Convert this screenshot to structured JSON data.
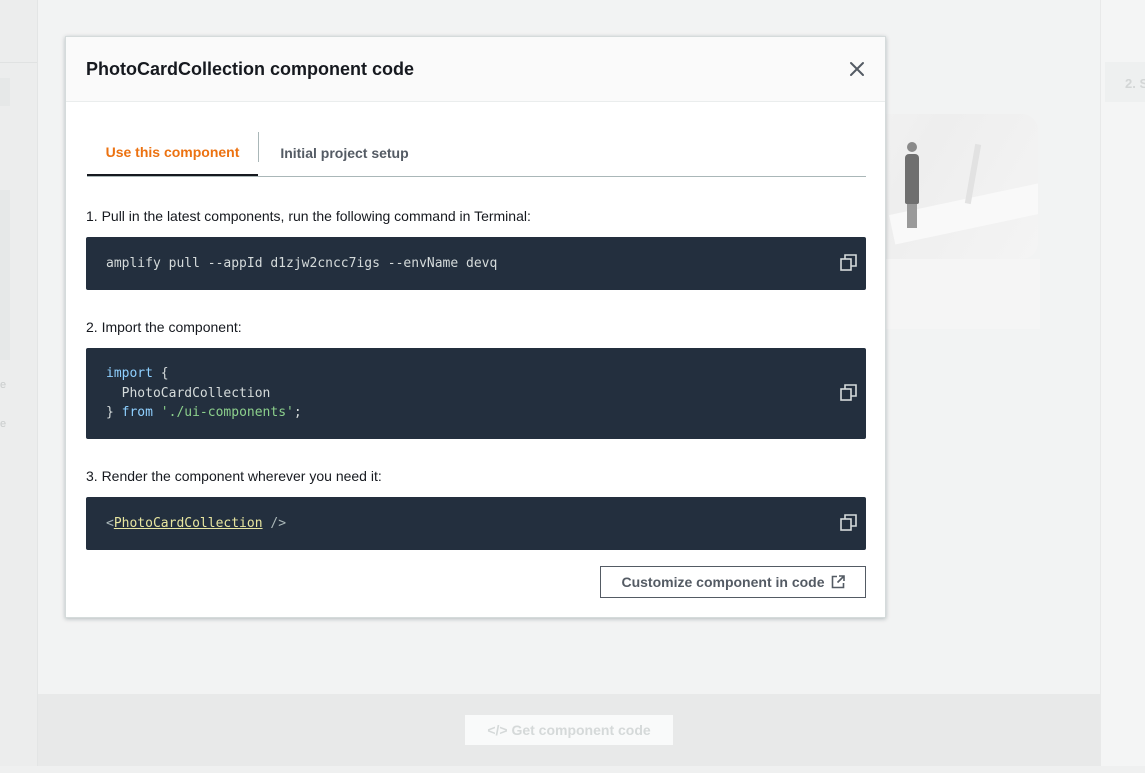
{
  "background": {
    "step_label": "2. S",
    "left_ghost_1": "e",
    "left_ghost_2": "e",
    "footer_button_label": "</> Get component code"
  },
  "modal": {
    "title": "PhotoCardCollection component code",
    "close_icon": "close-icon",
    "tabs": [
      {
        "label": "Use this component",
        "active": true
      },
      {
        "label": "Initial project setup",
        "active": false
      }
    ],
    "steps": [
      {
        "label": "1. Pull in the latest components, run the following command in Terminal:",
        "code": "amplify pull --appId d1zjw2cncc7igs --envName devq"
      },
      {
        "label": "2. Import the component:",
        "code_lines": {
          "l1_kw": "import",
          "l1_rest": " {",
          "l2": "  PhotoCardCollection",
          "l3_brace": "} ",
          "l3_kw": "from",
          "l3_space": " ",
          "l3_str": "'./ui-components'",
          "l3_end": ";"
        }
      },
      {
        "label": "3. Render the component wherever you need it:",
        "code_parts": {
          "open": "<",
          "component": "PhotoCardCollection",
          "close": " />"
        }
      }
    ],
    "copy_icon": "copy-icon",
    "customize_button_label": "Customize component in code",
    "external_link_icon": "external-link-icon"
  },
  "colors": {
    "active_tab": "#ec7211",
    "code_background": "#232f3e",
    "keyword": "#8fd0ff",
    "string": "#8cd08c"
  }
}
